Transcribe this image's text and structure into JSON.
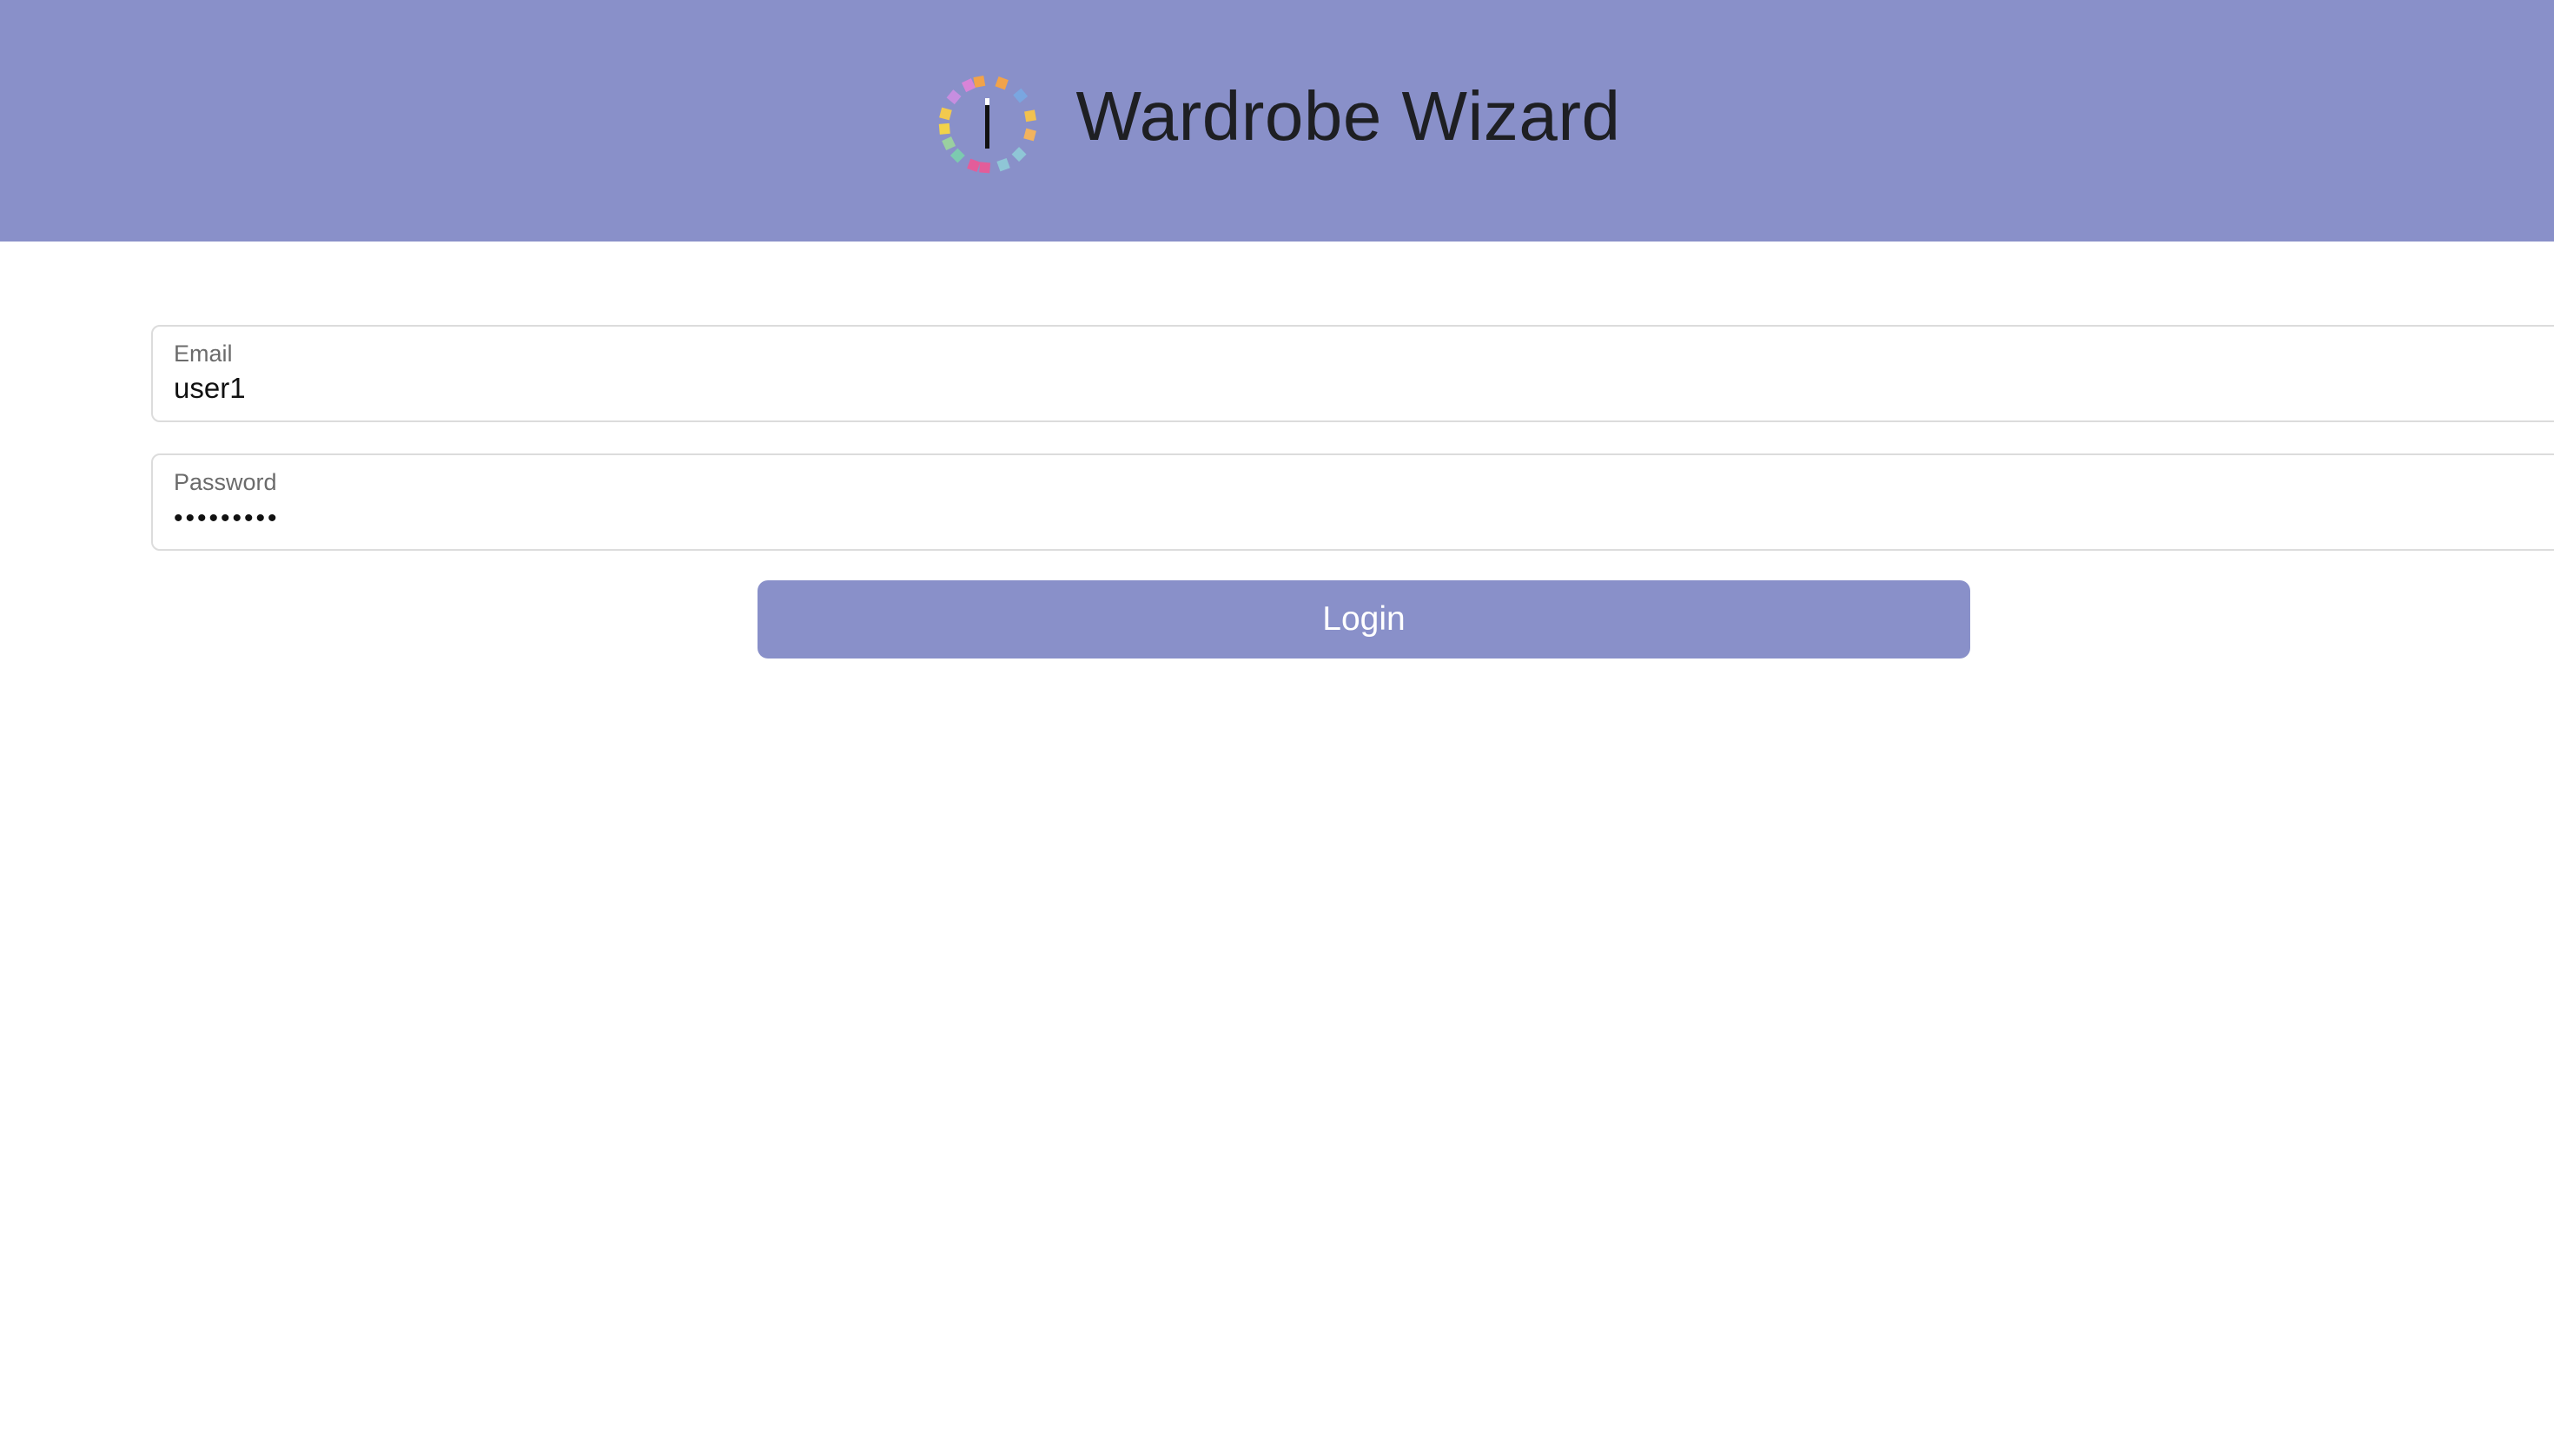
{
  "header": {
    "title": "Wardrobe Wizard",
    "logo_icon": "wardrobe-wizard-logo-icon",
    "background_color": "#8990c9"
  },
  "form": {
    "email": {
      "label": "Email",
      "value": "user1"
    },
    "password": {
      "label": "Password",
      "value": "•••••••••"
    },
    "login_label": "Login",
    "button_color": "#8990c9"
  }
}
